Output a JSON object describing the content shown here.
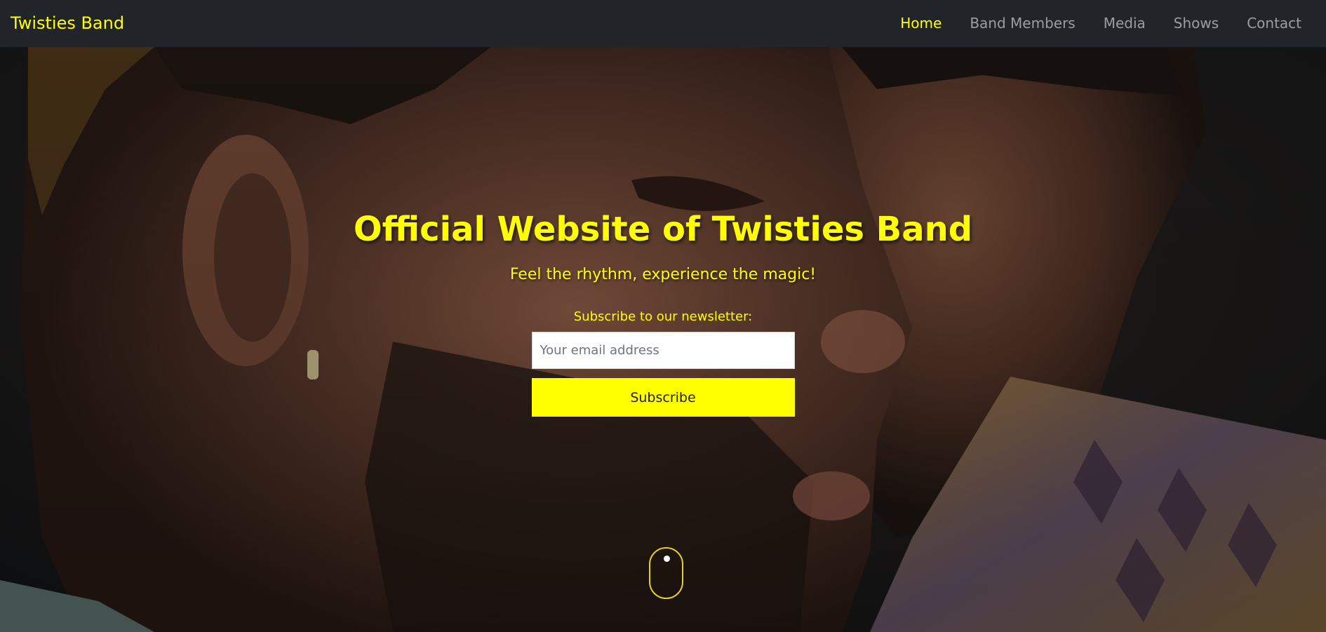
{
  "navbar": {
    "brand": "Twisties Band",
    "links": [
      {
        "label": "Home",
        "active": true
      },
      {
        "label": "Band Members",
        "active": false
      },
      {
        "label": "Media",
        "active": false
      },
      {
        "label": "Shows",
        "active": false
      },
      {
        "label": "Contact",
        "active": false
      }
    ]
  },
  "hero": {
    "title": "Official Website of Twisties Band",
    "tagline": "Feel the rhythm, experience the magic!",
    "background": "band-members-photo"
  },
  "newsletter": {
    "label": "Subscribe to our newsletter:",
    "email_placeholder": "Your email address",
    "email_value": "",
    "button_label": "Subscribe"
  },
  "scroll_indicator": {
    "icon": "mouse-scroll-icon"
  },
  "colors": {
    "accent": "#ffff00",
    "navbar_bg": "#212529",
    "nav_link": "#8c8e91"
  }
}
